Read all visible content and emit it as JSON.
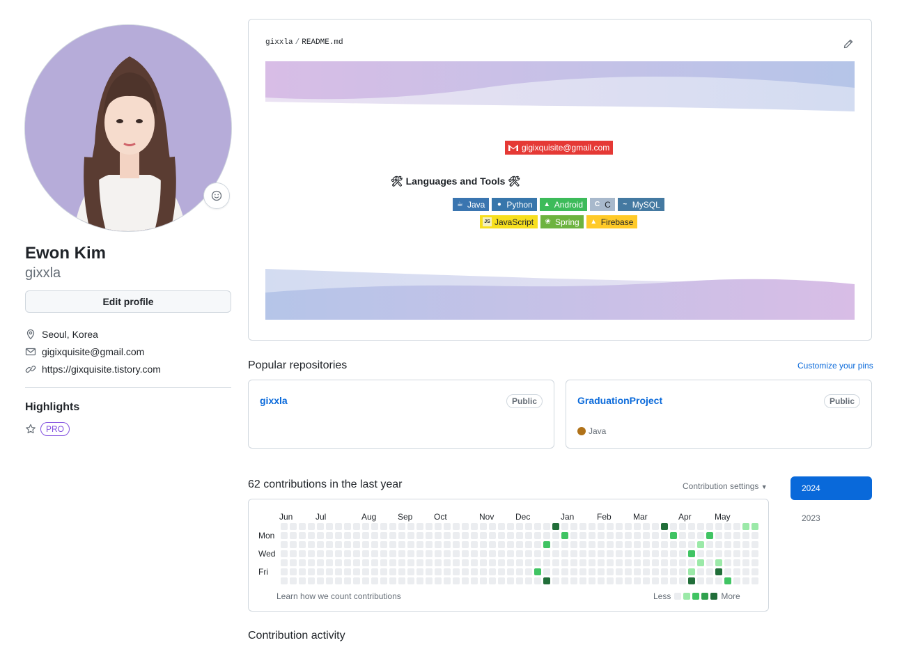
{
  "profile": {
    "full_name": "Ewon Kim",
    "username": "gixxla",
    "edit_profile_label": "Edit profile",
    "location": "Seoul, Korea",
    "email": "gigixquisite@gmail.com",
    "website": "https://gixquisite.tistory.com",
    "highlights_title": "Highlights",
    "pro_label": "PRO"
  },
  "readme": {
    "owner": "gixxla",
    "separator": "/",
    "file": "README.md",
    "mail_badge": "gigixquisite@gmail.com",
    "tools_title": "Languages and Tools",
    "badges_row1": [
      {
        "label": "Java",
        "color": "#3a75b0",
        "icon": "java-icon"
      },
      {
        "label": "Python",
        "color": "#3776ab",
        "icon": "python-icon"
      },
      {
        "label": "Android",
        "color": "#3ddc84",
        "icon": "android-icon"
      },
      {
        "label": "C",
        "color": "#a8b9cc",
        "icon": "c-icon"
      },
      {
        "label": "MySQL",
        "color": "#4479a1",
        "icon": "mysql-icon"
      }
    ],
    "badges_row2": [
      {
        "label": "JavaScript",
        "color": "#f7df1e",
        "icon": "js-icon"
      },
      {
        "label": "Spring",
        "color": "#6db33f",
        "icon": "spring-icon"
      },
      {
        "label": "Firebase",
        "color": "#ffca28",
        "icon": "firebase-icon"
      }
    ]
  },
  "popular": {
    "title": "Popular repositories",
    "customize_label": "Customize your pins",
    "repos": [
      {
        "name": "gixxla",
        "visibility": "Public",
        "language": ""
      },
      {
        "name": "GraduationProject",
        "visibility": "Public",
        "language": "Java",
        "language_color": "#b07219"
      }
    ]
  },
  "contributions": {
    "title": "62 contributions in the last year",
    "settings_label": "Contribution settings",
    "months": [
      "Jun",
      "Jul",
      "Aug",
      "Sep",
      "Oct",
      "Nov",
      "Dec",
      "Jan",
      "Feb",
      "Mar",
      "Apr",
      "May"
    ],
    "days": [
      "Mon",
      "Wed",
      "Fri"
    ],
    "learn_label": "Learn how we count contributions",
    "legend_less": "Less",
    "legend_more": "More",
    "legend_colors": [
      "#ebedf0",
      "#9be9a8",
      "#40c463",
      "#30a14e",
      "#216e39"
    ],
    "years": [
      "2024",
      "2023"
    ],
    "activity_title": "Contribution activity"
  }
}
